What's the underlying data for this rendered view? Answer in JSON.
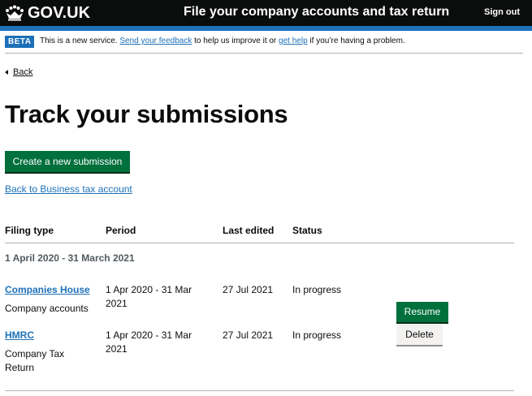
{
  "header": {
    "logo_text": "GOV.UK",
    "service_name": "File your company accounts and tax return",
    "sign_out": "Sign out"
  },
  "phase_banner": {
    "tag": "BETA",
    "text_before": "This is a new service. ",
    "feedback_link": "Send your feedback",
    "text_middle": " to help us improve it or ",
    "help_link": "get help",
    "text_after": " if you’re having a problem."
  },
  "back_link": "Back",
  "page_title": "Track your submissions",
  "create_button": "Create a new submission",
  "business_tax_link": "Back to Business tax account",
  "table": {
    "headers": [
      "Filing type",
      "Period",
      "Last edited",
      "Status"
    ],
    "group_caption": "1 April 2020 - 31 March 2021",
    "rows": [
      {
        "filing_type": "Companies House",
        "filing_desc": "Company accounts",
        "period": "1 Apr 2020 - 31 Mar 2021",
        "last_edited": "27 Jul 2021",
        "status": "In progress"
      },
      {
        "filing_type": "HMRC",
        "filing_desc": "Company Tax Return",
        "period": "1 Apr 2020 - 31 Mar 2021",
        "last_edited": "27 Jul 2021",
        "status": "In progress"
      }
    ],
    "actions": {
      "resume": "Resume",
      "delete": "Delete"
    }
  },
  "colors": {
    "header_bg": "#0b0c0c",
    "brand_blue": "#1d70b8",
    "button_green": "#00703c",
    "secondary_button": "#f3f2f1",
    "rule": "#b1b4b6"
  },
  "icons": [
    "crown-icon",
    "back-arrow-icon"
  ]
}
